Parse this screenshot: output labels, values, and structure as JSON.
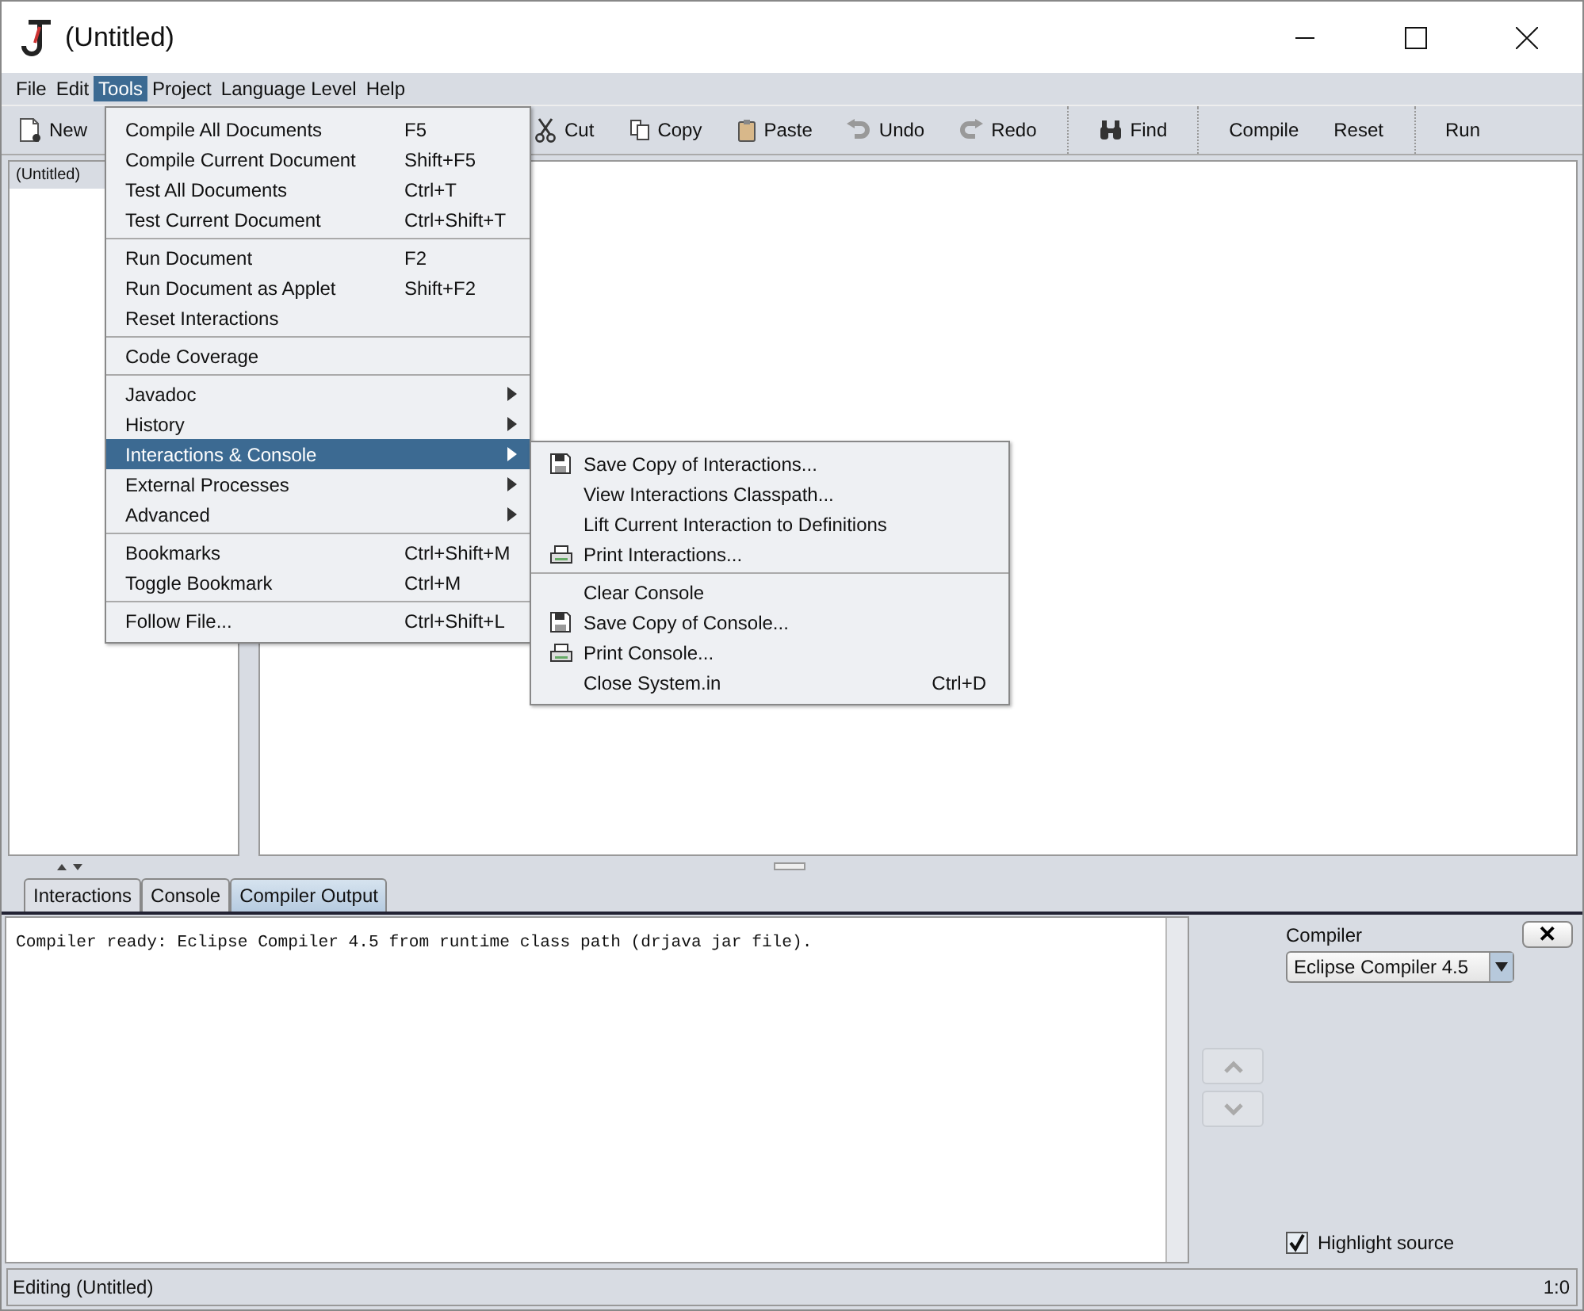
{
  "window": {
    "title": "(Untitled)"
  },
  "menubar": [
    {
      "label": "File",
      "selected": false
    },
    {
      "label": "Edit",
      "selected": false
    },
    {
      "label": "Tools",
      "selected": true
    },
    {
      "label": "Project",
      "selected": false
    },
    {
      "label": "Language Level",
      "selected": false
    },
    {
      "label": "Help",
      "selected": false
    }
  ],
  "toolbar": [
    [
      {
        "label": "New",
        "kind": "new"
      }
    ],
    [
      {
        "label": "Cut",
        "kind": "cut"
      },
      {
        "label": "Copy",
        "kind": "copy"
      },
      {
        "label": "Paste",
        "kind": "paste"
      },
      {
        "label": "Undo",
        "kind": "undo"
      },
      {
        "label": "Redo",
        "kind": "redo"
      }
    ],
    [
      {
        "label": "Find",
        "kind": "find"
      }
    ],
    [
      {
        "label": "Compile",
        "kind": "text"
      },
      {
        "label": "Reset",
        "kind": "text"
      }
    ],
    [
      {
        "label": "Run",
        "kind": "text"
      }
    ]
  ],
  "documents": [
    {
      "label": "(Untitled)",
      "selected": true
    }
  ],
  "tabs": [
    {
      "label": "Interactions",
      "selected": false
    },
    {
      "label": "Console",
      "selected": false
    },
    {
      "label": "Compiler Output",
      "selected": true
    }
  ],
  "output": {
    "text": "Compiler ready: Eclipse Compiler 4.5 from runtime class path (drjava jar file)."
  },
  "compiler_panel": {
    "label": "Compiler",
    "value": "Eclipse Compiler 4.5",
    "close": "✕",
    "highlight": {
      "label": "Highlight source",
      "checked": true
    }
  },
  "status_bar": {
    "message": "Editing (Untitled)",
    "position": "1:0"
  },
  "tools_menu": [
    {
      "kind": "item",
      "label": "Compile All Documents",
      "shortcut": "F5",
      "selected": false,
      "submenu": false
    },
    {
      "kind": "item",
      "label": "Compile Current Document",
      "shortcut": "Shift+F5",
      "selected": false,
      "submenu": false
    },
    {
      "kind": "item",
      "label": "Test All Documents",
      "shortcut": "Ctrl+T",
      "selected": false,
      "submenu": false
    },
    {
      "kind": "item",
      "label": "Test Current Document",
      "shortcut": "Ctrl+Shift+T",
      "selected": false,
      "submenu": false
    },
    {
      "kind": "separator"
    },
    {
      "kind": "item",
      "label": "Run Document",
      "shortcut": "F2",
      "selected": false,
      "submenu": false
    },
    {
      "kind": "item",
      "label": "Run Document as Applet",
      "shortcut": "Shift+F2",
      "selected": false,
      "submenu": false
    },
    {
      "kind": "item",
      "label": "Reset Interactions",
      "selected": false,
      "submenu": false
    },
    {
      "kind": "separator"
    },
    {
      "kind": "item",
      "label": "Code Coverage",
      "selected": false,
      "submenu": false
    },
    {
      "kind": "separator"
    },
    {
      "kind": "item",
      "label": "Javadoc",
      "selected": false,
      "submenu": true
    },
    {
      "kind": "item",
      "label": "History",
      "selected": false,
      "submenu": true
    },
    {
      "kind": "item",
      "label": "Interactions & Console",
      "selected": true,
      "submenu": true
    },
    {
      "kind": "item",
      "label": "External Processes",
      "selected": false,
      "submenu": true
    },
    {
      "kind": "item",
      "label": "Advanced",
      "selected": false,
      "submenu": true
    },
    {
      "kind": "separator"
    },
    {
      "kind": "item",
      "label": "Bookmarks",
      "shortcut": "Ctrl+Shift+M",
      "selected": false,
      "submenu": false
    },
    {
      "kind": "item",
      "label": "Toggle Bookmark",
      "shortcut": "Ctrl+M",
      "selected": false,
      "submenu": false
    },
    {
      "kind": "separator"
    },
    {
      "kind": "item",
      "label": "Follow File...",
      "shortcut": "Ctrl+Shift+L",
      "selected": false,
      "submenu": false
    }
  ],
  "submenu": [
    {
      "kind": "save",
      "label": "Save Copy of Interactions..."
    },
    {
      "kind": "plain",
      "label": "View Interactions Classpath..."
    },
    {
      "kind": "plain",
      "label": "Lift Current Interaction to Definitions"
    },
    {
      "kind": "print",
      "label": "Print Interactions..."
    },
    {
      "kind": "separator"
    },
    {
      "kind": "plain",
      "label": "Clear Console"
    },
    {
      "kind": "save",
      "label": "Save Copy of Console..."
    },
    {
      "kind": "print",
      "label": "Print Console..."
    },
    {
      "kind": "plain",
      "label": "Close System.in",
      "shortcut": "Ctrl+D"
    }
  ]
}
